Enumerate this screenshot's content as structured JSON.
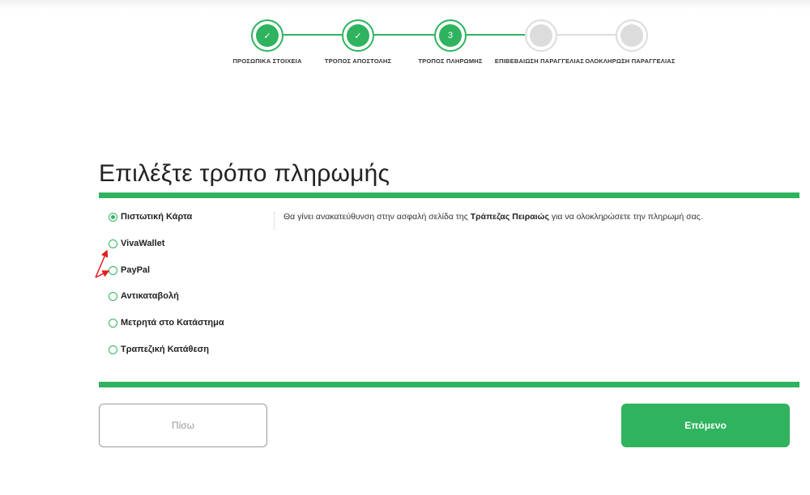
{
  "stepper": {
    "steps": [
      {
        "label": "ΠΡΟΣΩΠΙΚΑ ΣΤΟΙΧΕΙΑ",
        "state": "done",
        "content": "✓"
      },
      {
        "label": "ΤΡΟΠΟΣ ΑΠΟΣΤΟΛΗΣ",
        "state": "done",
        "content": "✓"
      },
      {
        "label": "ΤΡΟΠΟΣ ΠΛΗΡΩΜΗΣ",
        "state": "current",
        "content": "3"
      },
      {
        "label": "ΕΠΙΒΕΒΑΙΩΣΗ ΠΑΡΑΓΓΕΛΙΑΣ",
        "state": "pending",
        "content": ""
      },
      {
        "label": "ΟΛΟΚΛΗΡΩΣΗ ΠΑΡΑΓΓΕΛΙΑΣ",
        "state": "pending",
        "content": ""
      }
    ]
  },
  "page": {
    "title": "Επιλέξτε τρόπο πληρωμής"
  },
  "payment": {
    "options": [
      {
        "label": "Πιστωτική Κάρτα",
        "selected": true
      },
      {
        "label": "VivaWallet",
        "selected": false
      },
      {
        "label": "PayPal",
        "selected": false
      },
      {
        "label": "Αντικαταβολή",
        "selected": false
      },
      {
        "label": "Μετρητά στο Κατάστημα",
        "selected": false
      },
      {
        "label": "Τραπεζική Κατάθεση",
        "selected": false
      }
    ],
    "info_before": "Θα γίνει ανακατεύθυνση στην ασφαλή σελίδα της ",
    "info_bank": "Τράπεζας Πειραιώς",
    "info_after": " για να ολοκληρώσετε την πληρωμή σας."
  },
  "buttons": {
    "back_label": "Πίσω",
    "next_label": "Επόμενο"
  },
  "colors": {
    "accent": "#2fb35f",
    "pending": "#dcdcdc",
    "annotation": "#e02020"
  }
}
